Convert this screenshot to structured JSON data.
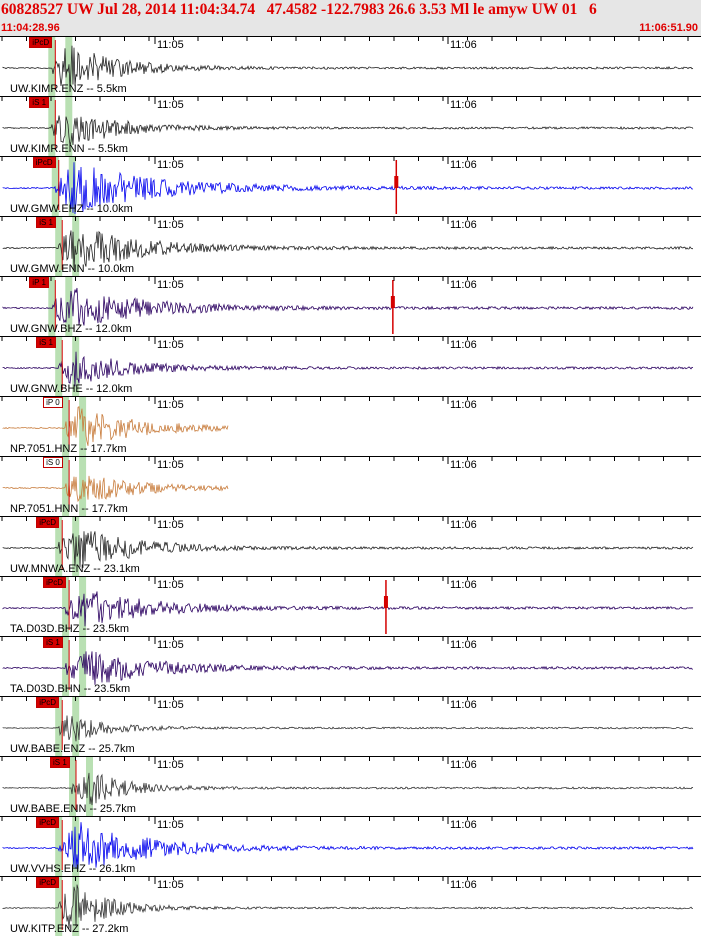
{
  "header": {
    "title": "60828527 UW Jul 28, 2014 11:04:34.74   47.4582 -122.7983 26.6 3.53 Ml le amyw UW 01   6",
    "time_start": "11:04:28.96",
    "time_end": "11:06:51.90"
  },
  "time_labels": [
    "11:05",
    "11:06"
  ],
  "colors": {
    "title": "#e00000",
    "header_bg": "#e6e6e6",
    "pick": "#d40000",
    "green_band": "#a8d8a0"
  },
  "channels": [
    {
      "label": "UW.KIMR.ENZ -- 5.5km",
      "pick": "iPcD",
      "pick_style": "filled",
      "color": "#222222",
      "amp": 0.95,
      "decay": 0.6,
      "onset": 0.07,
      "peak": 0.09,
      "glitch": null
    },
    {
      "label": "UW.KIMR.ENN -- 5.5km",
      "pick": "iS 1",
      "pick_style": "filled",
      "color": "#222222",
      "amp": 0.75,
      "decay": 0.6,
      "onset": 0.07,
      "peak": 0.095,
      "glitch": null
    },
    {
      "label": "UW.GMW.EHZ -- 10.0km",
      "pick": "iPcD",
      "pick_style": "filled",
      "color": "#0000ee",
      "amp": 1.0,
      "decay": 0.9,
      "onset": 0.075,
      "peak": 0.1,
      "glitch": 0.57
    },
    {
      "label": "UW.GMW.ENN -- 10.0km",
      "pick": "iS 1",
      "pick_style": "filled",
      "color": "#222222",
      "amp": 0.9,
      "decay": 0.8,
      "onset": 0.08,
      "peak": 0.1,
      "glitch": null
    },
    {
      "label": "UW.GNW.BHZ -- 12.0km",
      "pick": "iP 1",
      "pick_style": "filled",
      "color": "#2a0060",
      "amp": 0.8,
      "decay": 0.85,
      "onset": 0.07,
      "peak": 0.1,
      "glitch": 0.565
    },
    {
      "label": "UW.GNW.BHE -- 12.0km",
      "pick": "iS 1",
      "pick_style": "filled",
      "color": "#2a0060",
      "amp": 0.7,
      "decay": 0.7,
      "onset": 0.08,
      "peak": 0.1,
      "glitch": null
    },
    {
      "label": "NP.7051.HNZ -- 17.7km",
      "pick": "iP 0",
      "pick_style": "hollow",
      "color": "#c87c3c",
      "amp": 0.8,
      "decay": 0.7,
      "onset": 0.09,
      "peak": 0.11,
      "glitch": null
    },
    {
      "label": "NP.7051.HNN -- 17.7km",
      "pick": "iS 0",
      "pick_style": "hollow",
      "color": "#c87c3c",
      "amp": 0.6,
      "decay": 0.7,
      "onset": 0.09,
      "peak": 0.11,
      "glitch": null
    },
    {
      "label": "UW.MNWA.ENZ -- 23.1km",
      "pick": "iPcD",
      "pick_style": "filled",
      "color": "#222222",
      "amp": 0.85,
      "decay": 0.7,
      "onset": 0.08,
      "peak": 0.11,
      "glitch": null
    },
    {
      "label": "TA.D03D.BHZ -- 23.5km",
      "pick": "iPcD",
      "pick_style": "filled",
      "color": "#2a0060",
      "amp": 0.7,
      "decay": 0.8,
      "onset": 0.09,
      "peak": 0.12,
      "glitch": 0.555
    },
    {
      "label": "TA.D03D.BHN -- 23.5km",
      "pick": "iS 1",
      "pick_style": "filled",
      "color": "#2a0060",
      "amp": 0.75,
      "decay": 0.8,
      "onset": 0.09,
      "peak": 0.12,
      "glitch": null
    },
    {
      "label": "UW.BABE.ENZ -- 25.7km",
      "pick": "iPcD",
      "pick_style": "filled",
      "color": "#333333",
      "amp": 0.55,
      "decay": 0.3,
      "onset": 0.08,
      "peak": 0.1,
      "glitch": null
    },
    {
      "label": "UW.BABE.ENN -- 25.7km",
      "pick": "iS 1",
      "pick_style": "filled",
      "color": "#333333",
      "amp": 0.6,
      "decay": 0.4,
      "onset": 0.1,
      "peak": 0.13,
      "glitch": null
    },
    {
      "label": "UW.VVHS.EHZ -- 26.1km",
      "pick": "iPcD",
      "pick_style": "filled",
      "color": "#0000ee",
      "amp": 1.0,
      "decay": 0.8,
      "onset": 0.08,
      "peak": 0.11,
      "glitch": null
    },
    {
      "label": "UW.KITP.ENZ -- 27.2km",
      "pick": "iPcD",
      "pick_style": "filled",
      "color": "#333333",
      "amp": 1.0,
      "decay": 0.3,
      "onset": 0.08,
      "peak": 0.1,
      "glitch": null
    }
  ]
}
